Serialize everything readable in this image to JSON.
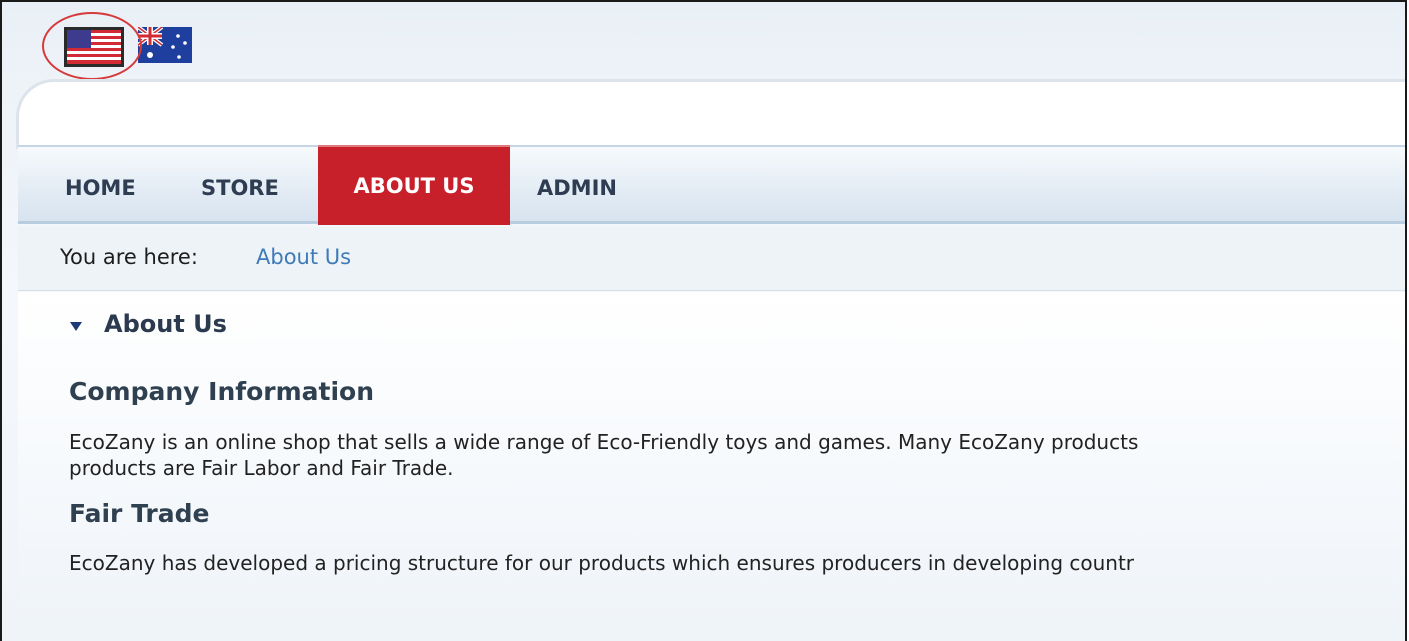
{
  "flags": {
    "us": {
      "icon": "us-flag-icon"
    },
    "au": {
      "icon": "australia-flag-icon"
    },
    "highlight_color": "#d63a3a"
  },
  "nav": {
    "items": [
      {
        "label": "HOME"
      },
      {
        "label": "STORE"
      },
      {
        "label": "ABOUT US",
        "active": true
      },
      {
        "label": "ADMIN"
      }
    ],
    "active_color": "#c8202a"
  },
  "breadcrumb": {
    "label": "You are here:",
    "current": "About Us"
  },
  "main": {
    "section_title": "About Us",
    "company_heading": "Company Information",
    "company_text": "EcoZany is an online shop that sells a wide range of Eco-Friendly toys and games. Many EcoZany products\nproducts are Fair Labor and Fair Trade.",
    "fair_heading": "Fair Trade",
    "fair_text": "EcoZany has developed a pricing structure for our products which ensures producers in developing countr"
  }
}
